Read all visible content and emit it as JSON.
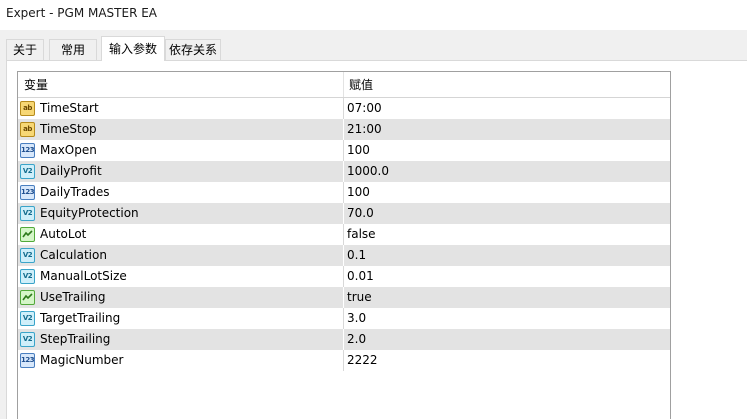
{
  "window": {
    "title": "Expert - PGM MASTER EA"
  },
  "tabs": [
    {
      "label": "关于"
    },
    {
      "label": "常用"
    },
    {
      "label": "输入参数"
    },
    {
      "label": "依存关系"
    }
  ],
  "active_tab": "输入参数",
  "table": {
    "columns": {
      "variable": "变量",
      "value": "赋值"
    },
    "rows": [
      {
        "name": "TimeStart",
        "value": "07:00",
        "type": "string",
        "icon": "string-type-icon",
        "icon_text": "ab"
      },
      {
        "name": "TimeStop",
        "value": "21:00",
        "type": "string",
        "icon": "string-type-icon",
        "icon_text": "ab"
      },
      {
        "name": "MaxOpen",
        "value": "100",
        "type": "int",
        "icon": "integer-type-icon",
        "icon_text": "123"
      },
      {
        "name": "DailyProfit",
        "value": "1000.0",
        "type": "double",
        "icon": "double-type-icon",
        "icon_text": "V2"
      },
      {
        "name": "DailyTrades",
        "value": "100",
        "type": "int",
        "icon": "integer-type-icon",
        "icon_text": "123"
      },
      {
        "name": "EquityProtection",
        "value": "70.0",
        "type": "double",
        "icon": "double-type-icon",
        "icon_text": "V2"
      },
      {
        "name": "AutoLot",
        "value": "false",
        "type": "bool",
        "icon": "bool-type-icon",
        "icon_text": ""
      },
      {
        "name": "Calculation",
        "value": "0.1",
        "type": "double",
        "icon": "double-type-icon",
        "icon_text": "V2"
      },
      {
        "name": "ManualLotSize",
        "value": "0.01",
        "type": "double",
        "icon": "double-type-icon",
        "icon_text": "V2"
      },
      {
        "name": "UseTrailing",
        "value": "true",
        "type": "bool",
        "icon": "bool-type-icon",
        "icon_text": ""
      },
      {
        "name": "TargetTrailing",
        "value": "3.0",
        "type": "double",
        "icon": "double-type-icon",
        "icon_text": "V2"
      },
      {
        "name": "StepTrailing",
        "value": "2.0",
        "type": "double",
        "icon": "double-type-icon",
        "icon_text": "V2"
      },
      {
        "name": "MagicNumber",
        "value": "2222",
        "type": "int",
        "icon": "integer-type-icon",
        "icon_text": "123"
      }
    ]
  },
  "colors": {
    "row_stripe": "#e3e3e3",
    "string_icon": "#f7d774",
    "int_icon": "#d8e8fb",
    "double_icon": "#cfeffa",
    "bool_icon": "#d5f6c8"
  }
}
